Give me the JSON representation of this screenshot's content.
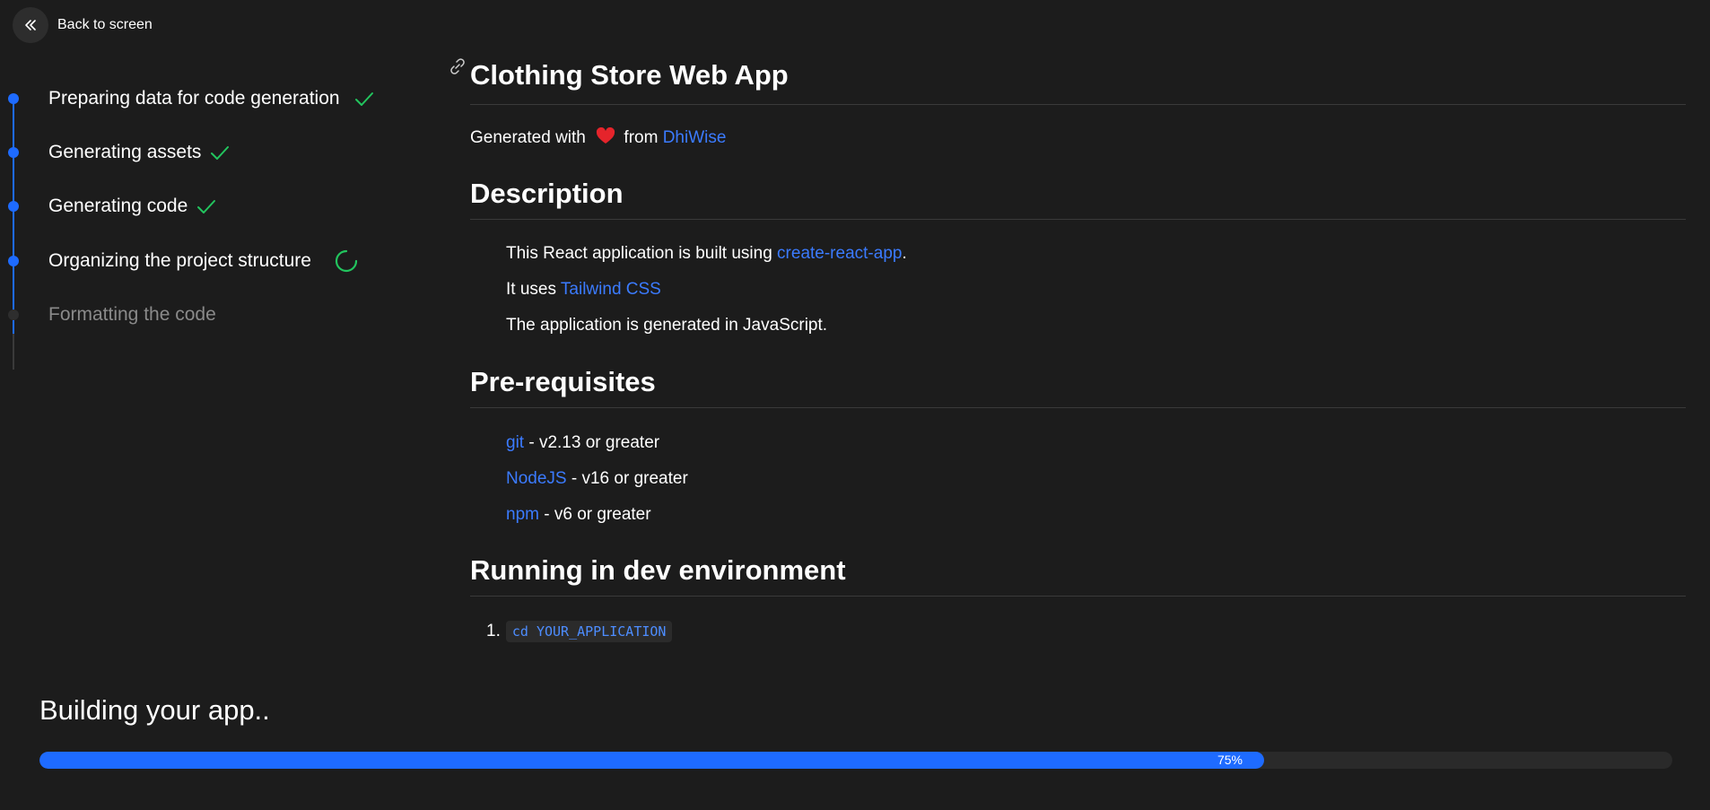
{
  "back": {
    "label": "Back to screen",
    "icon": "double-chevron-left-icon"
  },
  "steps": [
    {
      "label": "Preparing data for code generation",
      "status": "done"
    },
    {
      "label": "Generating assets",
      "status": "done"
    },
    {
      "label": "Generating code",
      "status": "done"
    },
    {
      "label": "Organizing the project structure",
      "status": "in-progress"
    },
    {
      "label": "Formatting the code",
      "status": "pending"
    }
  ],
  "doc": {
    "title": "Clothing Store Web App",
    "generated_prefix": "Generated with",
    "generated_from": "from",
    "generated_link": "DhiWise",
    "description_heading": "Description",
    "desc_line1_prefix": "This React application is built using",
    "desc_line1_link": "create-react-app",
    "desc_line1_suffix": ".",
    "desc_line2_prefix": "It uses",
    "desc_line2_link": "Tailwind CSS",
    "desc_line3": "The application is generated in JavaScript.",
    "prereq_heading": "Pre-requisites",
    "prereqs": [
      {
        "link": "git",
        "text": " - v2.13 or greater"
      },
      {
        "link": "NodeJS",
        "text": " - v16 or greater"
      },
      {
        "link": "npm",
        "text": " - v6 or greater"
      }
    ],
    "run_heading": "Running in dev environment",
    "run_step_number": "1.",
    "run_step_code": "cd YOUR_APPLICATION"
  },
  "build": {
    "title": "Building your app..",
    "progress_label": "75%",
    "progress": 0.75
  },
  "colors": {
    "accent": "#1e6bff",
    "success": "#22c55e",
    "heart": "#e5242b",
    "link": "#3b7bff"
  }
}
